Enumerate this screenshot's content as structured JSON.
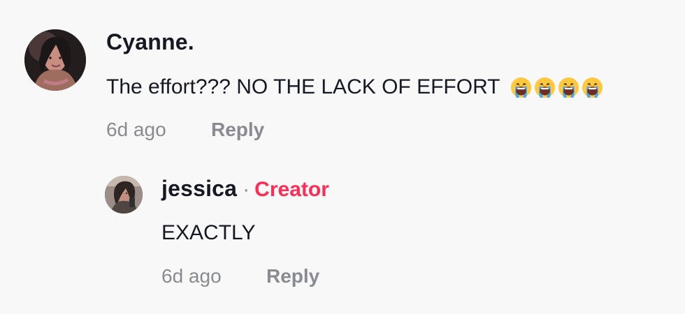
{
  "thread": {
    "main_comment": {
      "author": "Cyanne.",
      "text": "The effort??? NO THE LACK OF EFFORT",
      "emoji_icon": "loudly-crying-face",
      "emoji_count": 4,
      "timestamp": "6d ago",
      "reply_label": "Reply"
    },
    "reply_comment": {
      "author": "jessica",
      "separator": "·",
      "badge": "Creator",
      "text": "EXACTLY",
      "timestamp": "6d ago",
      "reply_label": "Reply"
    }
  },
  "colors": {
    "background": "#f8f8f8",
    "text": "#161823",
    "muted": "#8a8b91",
    "creator_accent": "#fe2c55"
  }
}
